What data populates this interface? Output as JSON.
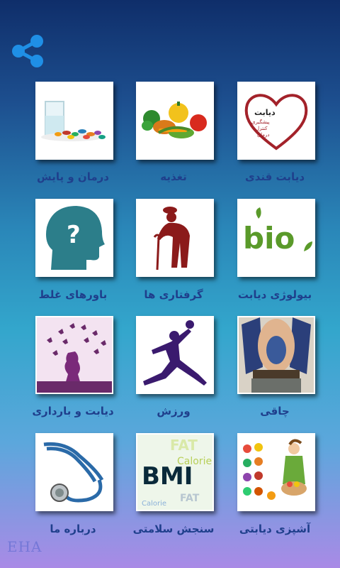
{
  "colors": {
    "accent": "#1f8fe6",
    "label": "#1f3f8c"
  },
  "share": {
    "icon": "share-icon"
  },
  "tiles": [
    {
      "label": "دیابت قندی",
      "icon": "heart-diabetes-icon",
      "heart_text": [
        "دیابت",
        "پیشگیری",
        "کنترل",
        "درمان"
      ]
    },
    {
      "label": "تغذیه",
      "icon": "vegetables-icon"
    },
    {
      "label": "درمان و پایش",
      "icon": "pills-glass-icon"
    },
    {
      "label": "بیولوژی دیابت",
      "icon": "bio-icon",
      "bio_text": "bio"
    },
    {
      "label": "گرفتاری ها",
      "icon": "elderly-man-icon"
    },
    {
      "label": "باورهای غلط",
      "icon": "head-question-icon",
      "q_mark": "?"
    },
    {
      "label": "چاقی",
      "icon": "obese-man-icon"
    },
    {
      "label": "ورزش",
      "icon": "jumpman-icon"
    },
    {
      "label": "دیابت و بارداری",
      "icon": "pregnancy-butterflies-icon"
    },
    {
      "label": "آشپزی دیابتی",
      "icon": "cooking-icon"
    },
    {
      "label": "سنجش سلامتی",
      "icon": "bmi-icon",
      "bmi_words": [
        "BMI",
        "FAT",
        "Calorie",
        "FAT",
        "Calorie"
      ]
    },
    {
      "label": "درباره ما",
      "icon": "stethoscope-icon"
    }
  ],
  "watermark": "EHA"
}
